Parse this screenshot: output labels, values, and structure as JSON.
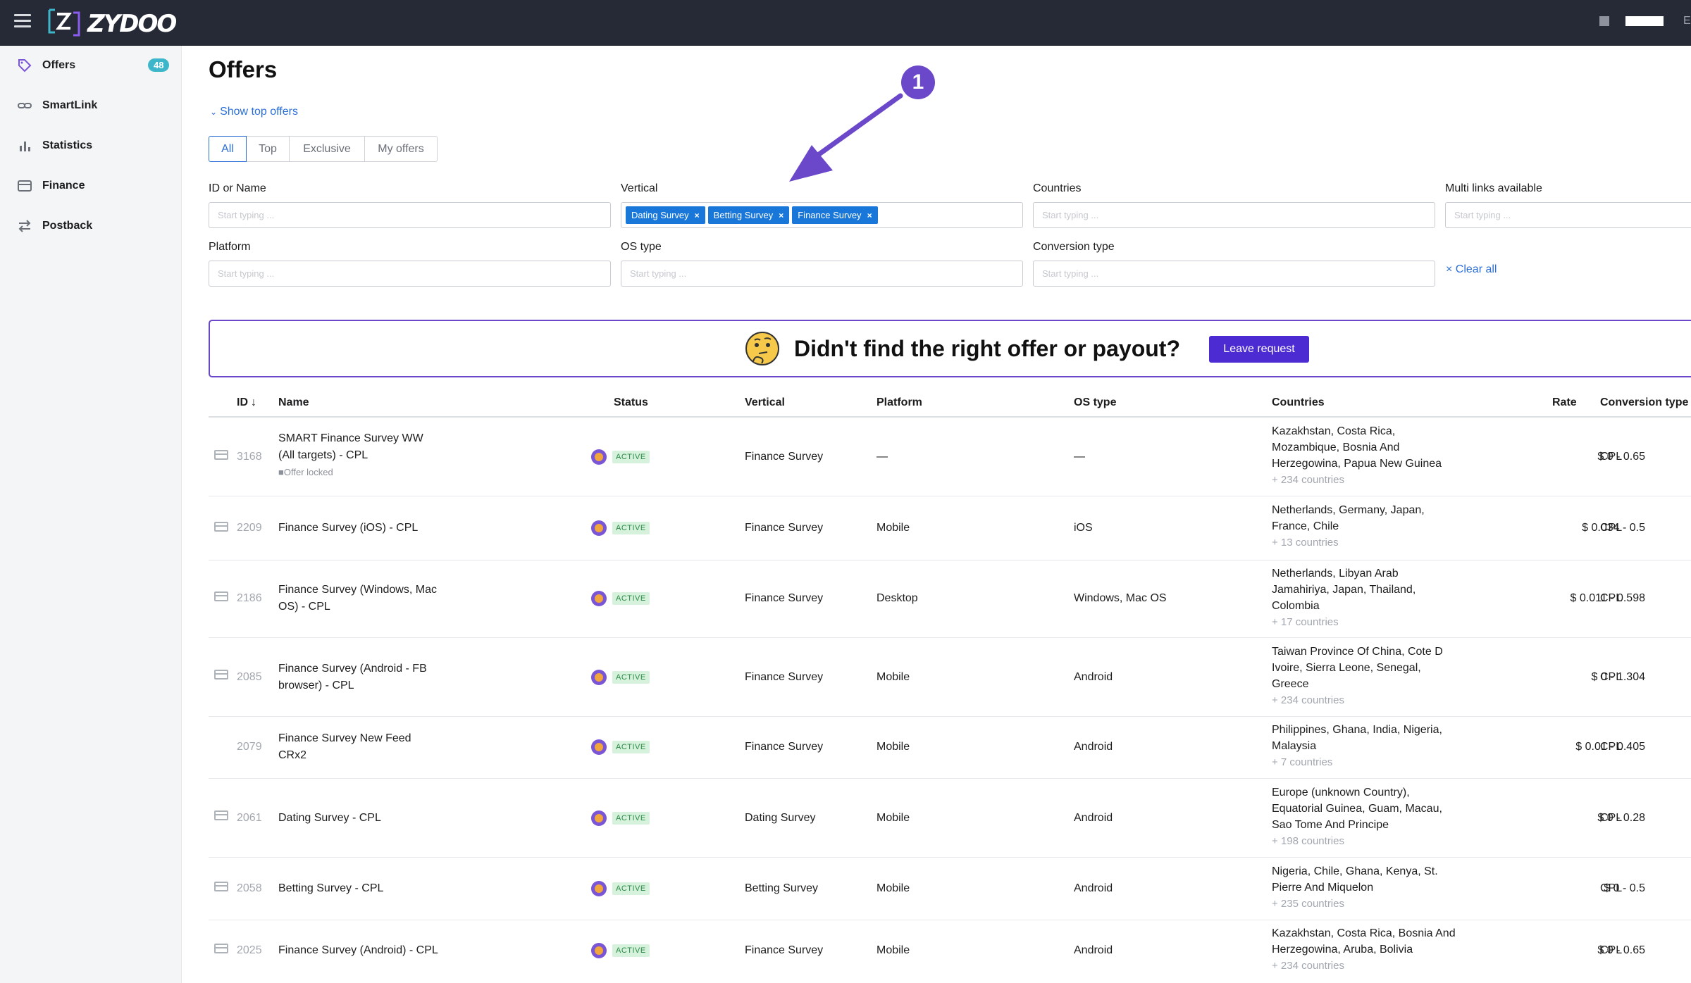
{
  "brand": {
    "name": "ZYDOO"
  },
  "topbar": {
    "edge_letter": "E"
  },
  "sidebar": {
    "items": [
      {
        "label": "Offers",
        "icon": "tag-icon",
        "badge": "48"
      },
      {
        "label": "SmartLink",
        "icon": "link-icon"
      },
      {
        "label": "Statistics",
        "icon": "bar-chart-icon"
      },
      {
        "label": "Finance",
        "icon": "card-icon"
      },
      {
        "label": "Postback",
        "icon": "swap-icon"
      }
    ]
  },
  "page": {
    "title": "Offers",
    "show_top": "Show top offers",
    "tabs": [
      "All",
      "Top",
      "Exclusive",
      "My offers"
    ],
    "active_tab": "All"
  },
  "filters": {
    "id_or_name": {
      "label": "ID or Name",
      "placeholder": "Start typing ..."
    },
    "vertical": {
      "label": "Vertical",
      "chips": [
        "Dating Survey",
        "Betting Survey",
        "Finance Survey"
      ]
    },
    "countries": {
      "label": "Countries",
      "placeholder": "Start typing ..."
    },
    "multi_links": {
      "label": "Multi links available",
      "placeholder": "Start typing ..."
    },
    "platform": {
      "label": "Platform",
      "placeholder": "Start typing ..."
    },
    "os_type": {
      "label": "OS type",
      "placeholder": "Start typing ..."
    },
    "conversion_type": {
      "label": "Conversion type",
      "placeholder": "Start typing ..."
    },
    "clear_all": "Clear all"
  },
  "banner": {
    "text": "Didn't find the right offer or payout?",
    "button": "Leave request"
  },
  "annotation": {
    "number": "1"
  },
  "table": {
    "headers": {
      "id": "ID",
      "name": "Name",
      "status": "Status",
      "vertical": "Vertical",
      "platform": "Platform",
      "os": "OS type",
      "countries": "Countries",
      "rate": "Rate",
      "conversion": "Conversion type"
    },
    "rows": [
      {
        "id": "3168",
        "name1": "SMART Finance Survey WW",
        "name2": "(All targets) - CPL",
        "locked": "Offer locked",
        "status": "ACTIVE",
        "vertical": "Finance Survey",
        "platform": "—",
        "os": "—",
        "c1": "Kazakhstan, Costa Rica,",
        "c2": "Mozambique, Bosnia And",
        "c3": "Herzegowina, Papua New Guinea",
        "more": "+ 234 countries",
        "rate": "$ 0 - 0.65",
        "conv": "CPL"
      },
      {
        "id": "2209",
        "name1": "Finance Survey (iOS) - CPL",
        "name2": "",
        "locked": "",
        "status": "ACTIVE",
        "vertical": "Finance Survey",
        "platform": "Mobile",
        "os": "iOS",
        "c1": "Netherlands, Germany, Japan,",
        "c2": "France, Chile",
        "c3": "",
        "more": "+ 13 countries",
        "rate": "$ 0.034 - 0.5",
        "conv": "CPL"
      },
      {
        "id": "2186",
        "name1": "Finance Survey (Windows, Mac",
        "name2": "OS) - CPL",
        "locked": "",
        "status": "ACTIVE",
        "vertical": "Finance Survey",
        "platform": "Desktop",
        "os": "Windows, Mac OS",
        "c1": "Netherlands, Libyan Arab",
        "c2": "Jamahiriya, Japan, Thailand,",
        "c3": "Colombia",
        "more": "+ 17 countries",
        "rate": "$ 0.011 - 0.598",
        "conv": "CPL"
      },
      {
        "id": "2085",
        "name1": "Finance Survey (Android - FB",
        "name2": "browser) - CPL",
        "locked": "",
        "status": "ACTIVE",
        "vertical": "Finance Survey",
        "platform": "Mobile",
        "os": "Android",
        "c1": "Taiwan Province Of China, Cote D",
        "c2": "Ivoire, Sierra Leone, Senegal,",
        "c3": "Greece",
        "more": "+ 234 countries",
        "rate": "$ 0 - 1.304",
        "conv": "CPL"
      },
      {
        "id": "2079",
        "name1": "Finance Survey New Feed",
        "name2": "CRx2",
        "locked": "",
        "status": "ACTIVE",
        "vertical": "Finance Survey",
        "platform": "Mobile",
        "os": "Android",
        "c1": "Philippines, Ghana, India, Nigeria,",
        "c2": "Malaysia",
        "c3": "",
        "more": "+ 7 countries",
        "rate": "$ 0.01 - 0.405",
        "conv": "CPL"
      },
      {
        "id": "2061",
        "name1": "Dating Survey - CPL",
        "name2": "",
        "locked": "",
        "status": "ACTIVE",
        "vertical": "Dating Survey",
        "platform": "Mobile",
        "os": "Android",
        "c1": "Europe (unknown Country),",
        "c2": "Equatorial Guinea, Guam, Macau,",
        "c3": "Sao Tome And Principe",
        "more": "+ 198 countries",
        "rate": "$ 0 - 0.28",
        "conv": "CPL"
      },
      {
        "id": "2058",
        "name1": "Betting Survey - CPL",
        "name2": "",
        "locked": "",
        "status": "ACTIVE",
        "vertical": "Betting Survey",
        "platform": "Mobile",
        "os": "Android",
        "c1": "Nigeria, Chile, Ghana, Kenya, St.",
        "c2": "Pierre And Miquelon",
        "c3": "",
        "more": "+ 235 countries",
        "rate": "$ 0 - 0.5",
        "conv": "CPL"
      },
      {
        "id": "2025",
        "name1": "Finance Survey (Android) - CPL",
        "name2": "",
        "locked": "",
        "status": "ACTIVE",
        "vertical": "Finance Survey",
        "platform": "Mobile",
        "os": "Android",
        "c1": "Kazakhstan, Costa Rica, Bosnia And",
        "c2": "Herzegowina, Aruba, Bolivia",
        "c3": "",
        "more": "+ 234 countries",
        "rate": "$ 0 - 0.65",
        "conv": "CPL"
      }
    ]
  },
  "colors": {
    "accent": "#2b6fd6",
    "brand_purple": "#4c2bd3",
    "topbar": "#262a36"
  }
}
